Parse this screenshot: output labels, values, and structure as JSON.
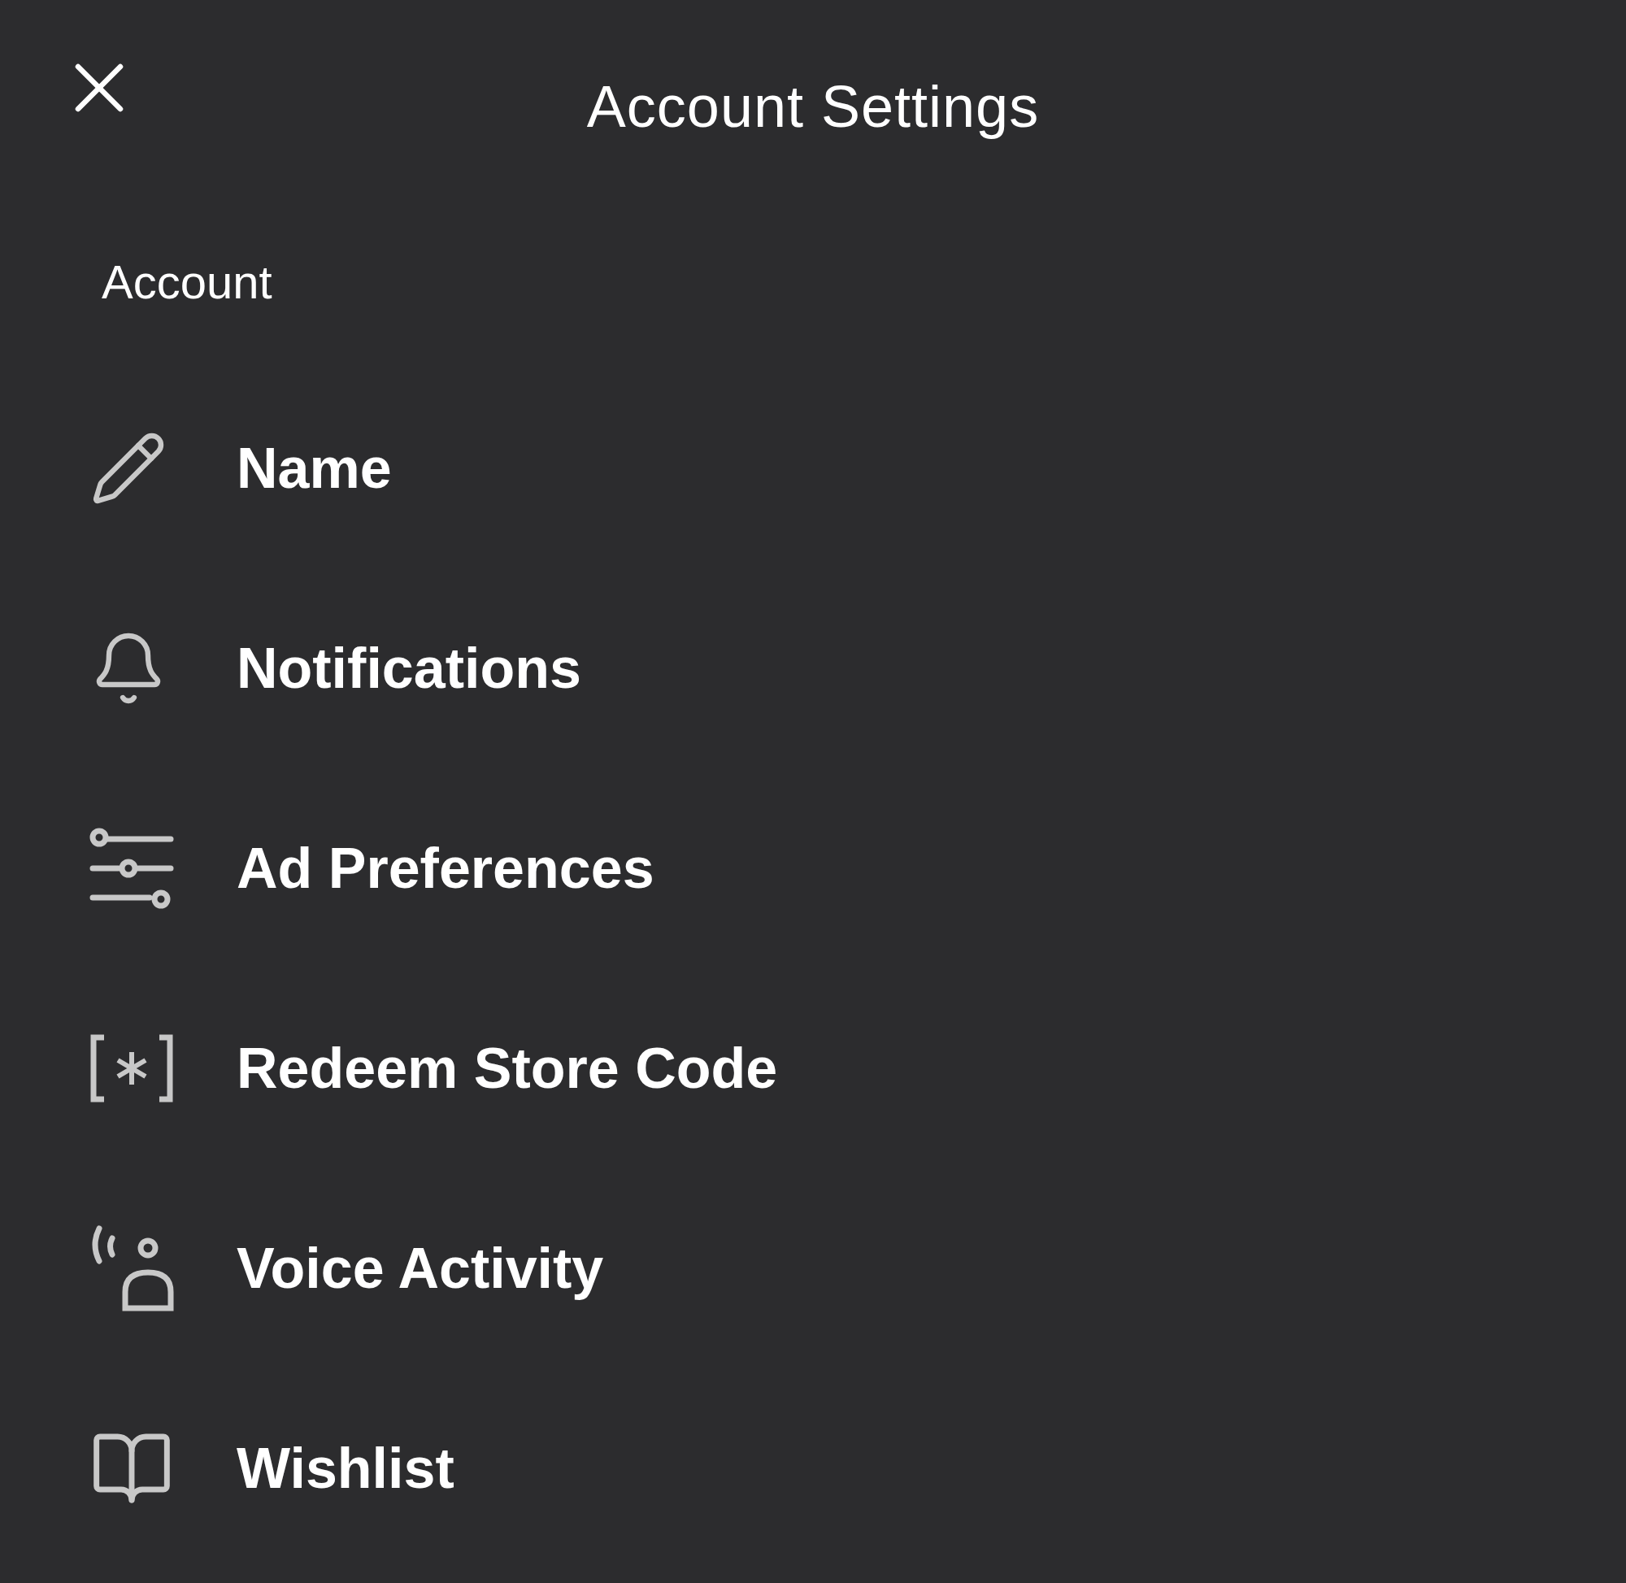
{
  "header": {
    "title": "Account Settings"
  },
  "section": {
    "label": "Account"
  },
  "items": [
    {
      "kind": "pencil",
      "label": "Name"
    },
    {
      "kind": "bell",
      "label": "Notifications"
    },
    {
      "kind": "sliders",
      "label": "Ad Preferences"
    },
    {
      "kind": "code",
      "label": "Redeem Store Code"
    },
    {
      "kind": "voice",
      "label": "Voice Activity"
    },
    {
      "kind": "book",
      "label": "Wishlist"
    }
  ]
}
